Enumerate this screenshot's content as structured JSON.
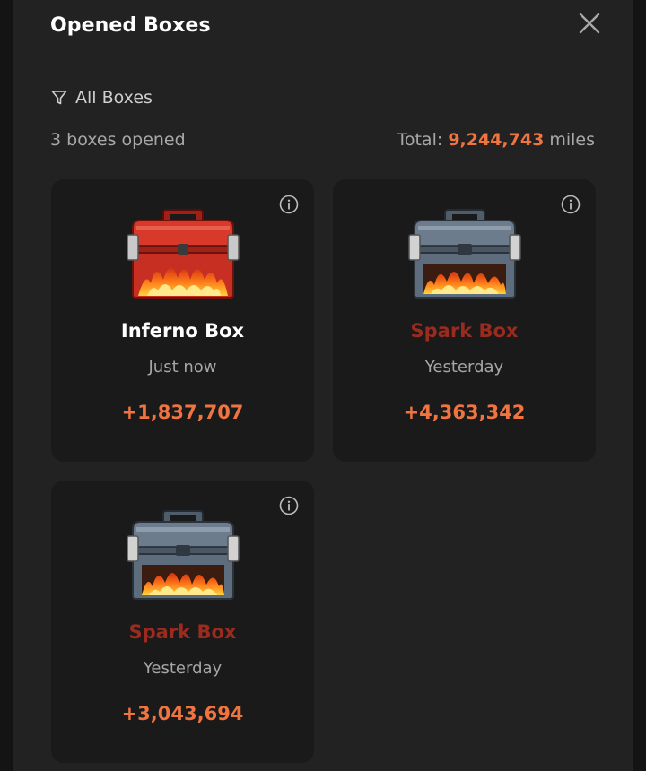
{
  "header": {
    "title": "Opened Boxes"
  },
  "filter": {
    "label": "All Boxes"
  },
  "summary": {
    "count_text": "3 boxes opened",
    "total_label": "Total:",
    "total_value": "9,244,743",
    "total_unit": "miles"
  },
  "colors": {
    "accent": "#ef7440",
    "spark_name": "#9b2a1f",
    "inferno_name": "#ffffff",
    "card_bg": "#1b1a1a",
    "modal_bg": "#222222"
  },
  "boxes": [
    {
      "name": "Inferno Box",
      "time": "Just now",
      "amount": "+1,837,707",
      "icon": "red-chest-icon"
    },
    {
      "name": "Spark Box",
      "time": "Yesterday",
      "amount": "+4,363,342",
      "icon": "gray-chest-icon"
    },
    {
      "name": "Spark Box",
      "time": "Yesterday",
      "amount": "+3,043,694",
      "icon": "gray-chest-icon"
    }
  ]
}
